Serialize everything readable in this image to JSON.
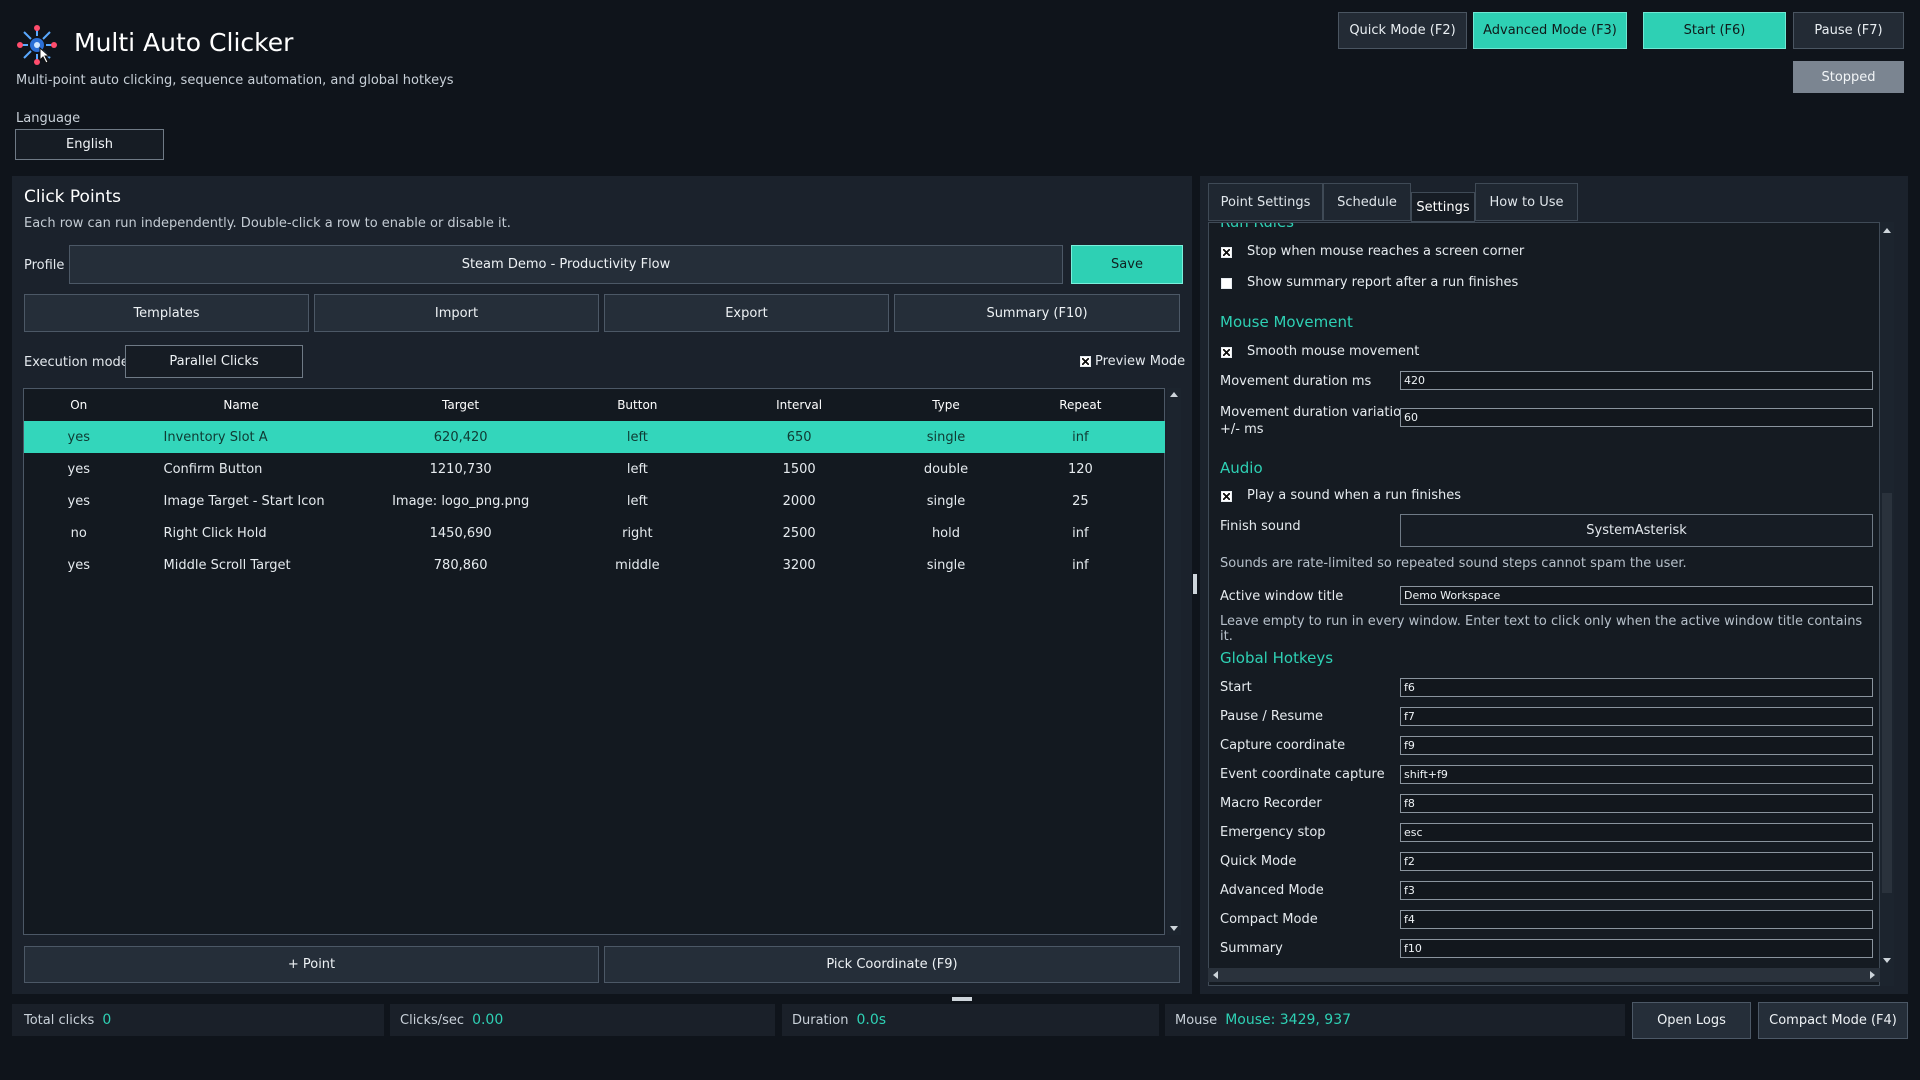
{
  "header": {
    "title": "Multi Auto Clicker",
    "subtitle": "Multi-point auto clicking, sequence automation, and global hotkeys",
    "language_label": "Language",
    "language_value": "English",
    "buttons": {
      "quick_mode": "Quick Mode (F2)",
      "advanced_mode": "Advanced Mode (F3)",
      "start": "Start (F6)",
      "pause": "Pause (F7)"
    },
    "status": "Stopped"
  },
  "click_points": {
    "title": "Click Points",
    "subtitle": "Each row can run independently. Double-click a row to enable or disable it.",
    "profile_label": "Profile",
    "profile_value": "Steam Demo - Productivity Flow",
    "save": "Save",
    "templates": "Templates",
    "import": "Import",
    "export": "Export",
    "summary": "Summary (F10)",
    "execution_label": "Execution mode",
    "execution_value": "Parallel Clicks",
    "preview_mode": "Preview Mode",
    "columns": [
      "On",
      "Name",
      "Target",
      "Button",
      "Interval",
      "Type",
      "Repeat"
    ],
    "rows": [
      {
        "on": "yes",
        "name": "Inventory Slot A",
        "target": "620,420",
        "button": "left",
        "interval": "650",
        "type": "single",
        "repeat": "inf"
      },
      {
        "on": "yes",
        "name": "Confirm Button",
        "target": "1210,730",
        "button": "left",
        "interval": "1500",
        "type": "double",
        "repeat": "120"
      },
      {
        "on": "yes",
        "name": "Image Target - Start Icon",
        "target": "Image: logo_png.png",
        "button": "left",
        "interval": "2000",
        "type": "single",
        "repeat": "25"
      },
      {
        "on": "no",
        "name": "Right Click Hold",
        "target": "1450,690",
        "button": "right",
        "interval": "2500",
        "type": "hold",
        "repeat": "inf"
      },
      {
        "on": "yes",
        "name": "Middle Scroll Target",
        "target": "780,860",
        "button": "middle",
        "interval": "3200",
        "type": "single",
        "repeat": "inf"
      }
    ],
    "add_point": "+ Point",
    "pick_coordinate": "Pick Coordinate (F9)"
  },
  "tabs": [
    "Point Settings",
    "Schedule",
    "Settings",
    "How to Use"
  ],
  "settings": {
    "run_rules_heading": "Run Rules",
    "stop_corner": "Stop when mouse reaches a screen corner",
    "show_summary": "Show summary report after a run finishes",
    "mouse_heading": "Mouse Movement",
    "smooth_mouse": "Smooth mouse movement",
    "move_duration_label": "Movement duration ms",
    "move_duration_value": "420",
    "move_variation_label1": "Movement duration variation",
    "move_variation_label2": "+/- ms",
    "move_variation_value": "60",
    "audio_heading": "Audio",
    "play_sound": "Play a sound when a run finishes",
    "finish_sound_label": "Finish sound",
    "finish_sound_value": "SystemAsterisk",
    "sound_note": "Sounds are rate-limited so repeated sound steps cannot spam the user.",
    "active_window_label": "Active window title",
    "active_window_value": "Demo Workspace",
    "active_window_note": "Leave empty to run in every window. Enter text to click only when the active window title contains it.",
    "hotkeys_heading": "Global Hotkeys",
    "hotkeys": [
      {
        "label": "Start",
        "value": "f6"
      },
      {
        "label": "Pause / Resume",
        "value": "f7"
      },
      {
        "label": "Capture coordinate",
        "value": "f9"
      },
      {
        "label": "Event coordinate capture",
        "value": "shift+f9"
      },
      {
        "label": "Macro Recorder",
        "value": "f8"
      },
      {
        "label": "Emergency stop",
        "value": "esc"
      },
      {
        "label": "Quick Mode",
        "value": "f2"
      },
      {
        "label": "Advanced Mode",
        "value": "f3"
      },
      {
        "label": "Compact Mode",
        "value": "f4"
      },
      {
        "label": "Summary",
        "value": "f10"
      }
    ]
  },
  "footer": {
    "total_clicks_label": "Total clicks",
    "total_clicks_value": "0",
    "cps_label": "Clicks/sec",
    "cps_value": "0.00",
    "duration_label": "Duration",
    "duration_value": "0.0s",
    "mouse_label": "Mouse",
    "mouse_value": "Mouse: 3429, 937",
    "open_logs": "Open Logs",
    "compact_mode": "Compact Mode (F4)"
  },
  "colors": {
    "accent": "#2ed0b4",
    "background": "#0f141b",
    "panel": "#1b222c"
  }
}
